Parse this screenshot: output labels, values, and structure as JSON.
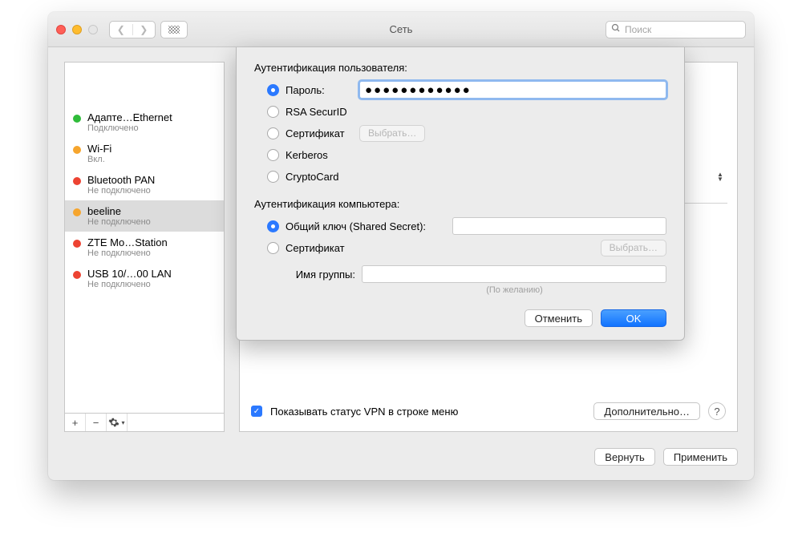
{
  "window_title": "Сеть",
  "search_placeholder": "Поиск",
  "sidebar": {
    "items": [
      {
        "name": "Адапте…Ethernet",
        "status": "Подключено",
        "dot": "green",
        "selected": false
      },
      {
        "name": "Wi-Fi",
        "status": "Вкл.",
        "dot": "orange",
        "selected": false
      },
      {
        "name": "Bluetooth PAN",
        "status": "Не подключено",
        "dot": "red",
        "selected": false
      },
      {
        "name": "beeline",
        "status": "Не подключено",
        "dot": "orange",
        "selected": true
      },
      {
        "name": "ZTE Mo…Station",
        "status": "Не подключено",
        "dot": "red",
        "selected": false
      },
      {
        "name": "USB 10/…00 LAN",
        "status": "Не подключено",
        "dot": "red",
        "selected": false
      }
    ]
  },
  "main": {
    "vpn_menu_checkbox_label": "Показывать статус VPN в строке меню",
    "advanced_button": "Дополнительно…"
  },
  "bottom": {
    "revert": "Вернуть",
    "apply": "Применить"
  },
  "sheet": {
    "user_auth_heading": "Аутентификация пользователя:",
    "password_label": "Пароль:",
    "password_value": "●●●●●●●●●●●●",
    "rsa_label": "RSA SecurID",
    "cert_label": "Сертификат",
    "cert_select_btn": "Выбрать…",
    "kerberos_label": "Kerberos",
    "cryptocard_label": "CryptoCard",
    "machine_auth_heading": "Аутентификация компьютера:",
    "shared_secret_label": "Общий ключ (Shared Secret):",
    "machine_cert_label": "Сертификат",
    "machine_cert_btn": "Выбрать…",
    "group_label": "Имя группы:",
    "group_hint": "(По желанию)",
    "cancel": "Отменить",
    "ok": "OK"
  }
}
